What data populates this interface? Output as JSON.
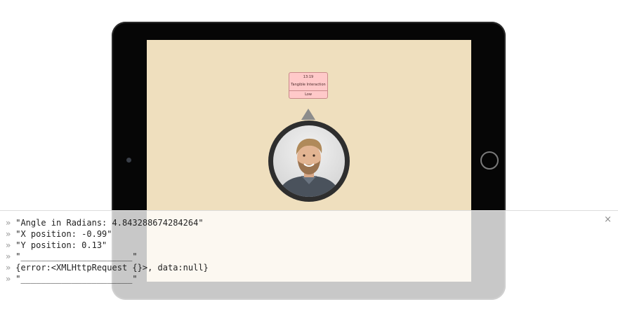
{
  "screen": {
    "card": {
      "time": "13:19",
      "title": "Tangible Interaction",
      "level": "Low"
    },
    "avatar_icon": "profile-photo"
  },
  "console": {
    "close_label": "×",
    "prompt_glyph": "»",
    "lines": [
      "\"Angle in Radians: 4.843288674284264\"",
      "\"X position: -0.99\"",
      "\"Y position: 0.13\"",
      "\"______________________\"",
      "{error:<XMLHttpRequest {}>, data:null}",
      "\"______________________\""
    ]
  },
  "colors": {
    "screen_bg": "#efdfbe",
    "card_bg": "#ffc9c9",
    "device": "#060606"
  }
}
